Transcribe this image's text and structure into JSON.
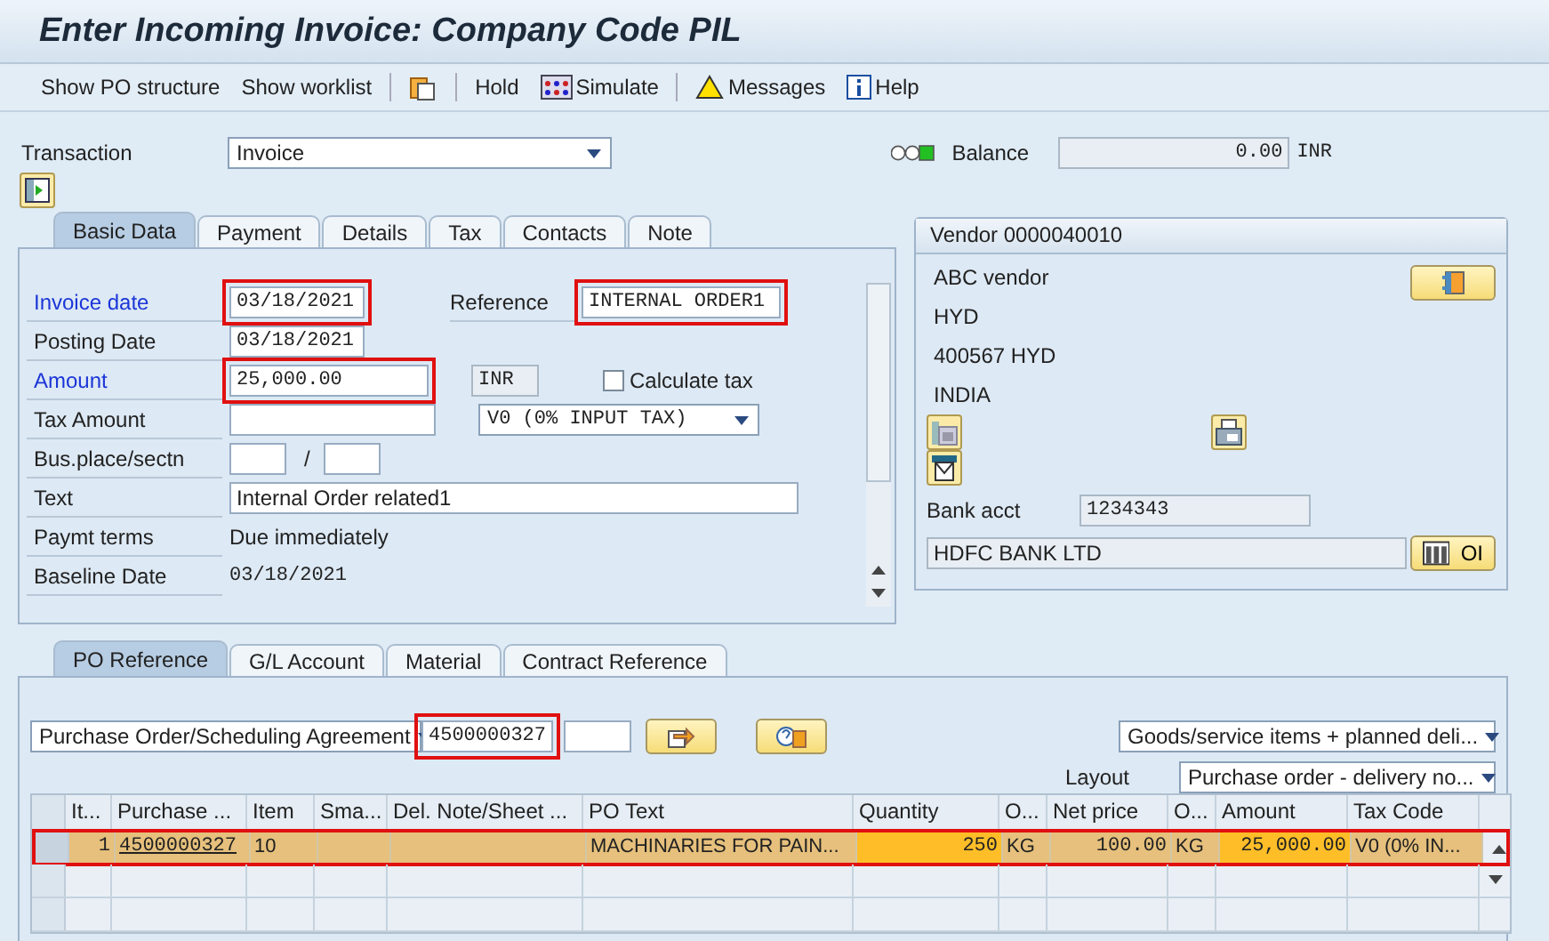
{
  "window": {
    "title": "Enter Incoming Invoice: Company Code PIL"
  },
  "toolbar": [
    {
      "kind": "plain",
      "label": "Show PO structure"
    },
    {
      "kind": "plain",
      "label": "Show worklist"
    },
    {
      "kind": "separator"
    },
    {
      "kind": "copy"
    },
    {
      "kind": "separator"
    },
    {
      "kind": "plain",
      "label": "Hold"
    },
    {
      "kind": "simulate",
      "label": "Simulate"
    },
    {
      "kind": "separator"
    },
    {
      "kind": "messages",
      "label": "Messages"
    },
    {
      "kind": "help",
      "label": "Help"
    }
  ],
  "transaction": {
    "label": "Transaction",
    "value": "Invoice"
  },
  "balance": {
    "label": "Balance",
    "value": "0.00",
    "currency": "INR"
  },
  "invoice_tabs": [
    {
      "label": "Basic Data",
      "selected": true
    },
    {
      "label": "Payment",
      "selected": false
    },
    {
      "label": "Details",
      "selected": false
    },
    {
      "label": "Tax",
      "selected": false
    },
    {
      "label": "Contacts",
      "selected": false
    },
    {
      "label": "Note",
      "selected": false
    }
  ],
  "basic_data": {
    "invoice_date": {
      "label": "Invoice date",
      "value": "03/18/2021",
      "required": true,
      "highlighted": true
    },
    "reference": {
      "label": "Reference",
      "value": "INTERNAL ORDER1",
      "highlighted": true
    },
    "posting_date": {
      "label": "Posting Date",
      "value": "03/18/2021",
      "required": false
    },
    "amount": {
      "label": "Amount",
      "value": "25,000.00",
      "required": true,
      "highlighted": true
    },
    "currency": "INR",
    "calculate_tax": {
      "label": "Calculate tax",
      "checked": false
    },
    "tax_amount": {
      "label": "Tax Amount",
      "required": false
    },
    "tax_code": "V0 (0% INPUT TAX)",
    "bus_place": {
      "label": "Bus.place/sectn",
      "separator": "/",
      "required": false
    },
    "text": {
      "label": "Text",
      "value": "Internal Order related1",
      "required": false
    },
    "payment_terms": {
      "label": "Paymt terms",
      "value": "Due immediately",
      "required": false
    },
    "baseline_date": {
      "label": "Baseline Date",
      "value": "03/18/2021",
      "required": false
    }
  },
  "vendor": {
    "title": "Vendor 0000040010",
    "lines": [
      "ABC vendor",
      "HYD",
      "400567 HYD",
      "INDIA"
    ],
    "bank_label": "Bank acct",
    "bank_account": "1234343",
    "bank_name": "HDFC BANK LTD",
    "oi_label": "OI"
  },
  "po_tabs": [
    {
      "label": "PO Reference",
      "selected": true
    },
    {
      "label": "G/L Account",
      "selected": false
    },
    {
      "label": "Material",
      "selected": false
    },
    {
      "label": "Contract Reference",
      "selected": false
    }
  ],
  "po": {
    "reference_type": "Purchase Order/Scheduling Agreement",
    "po_number": "4500000327",
    "po_number_highlighted": true,
    "item_selection": "Goods/service items + planned deli...",
    "layout_label": "Layout",
    "layout": "Purchase order - delivery no..."
  },
  "table": {
    "columns": [
      "It...",
      "Purchase ...",
      "Item",
      "Sma...",
      "Del. Note/Sheet ...",
      "PO Text",
      "Quantity",
      "O...",
      "Net price",
      "O...",
      "Amount",
      "Tax Code"
    ],
    "rows": [
      {
        "selected": true,
        "highlighted": true,
        "cells": [
          {
            "text": "1",
            "kind": "number"
          },
          {
            "text": "4500000327",
            "kind": "link"
          },
          {
            "text": "10",
            "kind": "text"
          },
          {
            "text": "",
            "kind": "text"
          },
          {
            "text": "",
            "kind": "text"
          },
          {
            "text": "MACHINARIES FOR PAIN...",
            "kind": "text"
          },
          {
            "text": "250",
            "kind": "input"
          },
          {
            "text": "KG",
            "kind": "text"
          },
          {
            "text": "100.00",
            "kind": "number"
          },
          {
            "text": "KG",
            "kind": "text"
          },
          {
            "text": "25,000.00",
            "kind": "input"
          },
          {
            "text": "V0 (0% IN...",
            "kind": "text"
          }
        ]
      }
    ]
  }
}
